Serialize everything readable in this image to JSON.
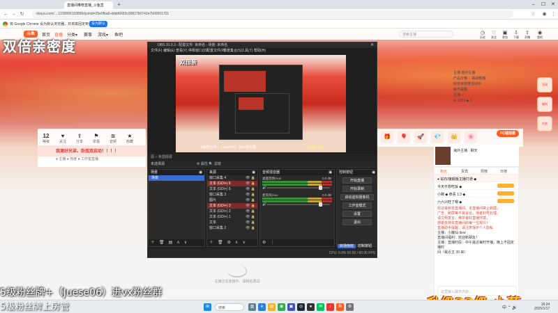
{
  "browser": {
    "tab_title": "直播间推荐直播_斗鱼直",
    "url": "douyu.com/... 1239006118896dyshid=25e0fba0-dddd6693c00837b0742e7b00001701",
    "infobar_msg": "将 Google Chrome 设为默认浏览器，并将其固定到任务栏",
    "infobar_btn": "设为默认"
  },
  "site": {
    "logo": "斗鱼",
    "nav_items": [
      "首页",
      "直播",
      "分类▾",
      "赛事",
      "游戏▾",
      "鱼吧"
    ],
    "search_placeholder": "搜索主播",
    "nav_icons": [
      {
        "icon": "history-icon",
        "label": "历史"
      },
      {
        "icon": "follow-icon",
        "label": "关注"
      },
      {
        "icon": "gift-icon",
        "label": "背包"
      },
      {
        "icon": "download-icon",
        "label": "下载"
      },
      {
        "icon": "upload-icon",
        "label": "开播"
      },
      {
        "icon": "user-icon",
        "label": "我的"
      }
    ],
    "stats": [
      {
        "value": "12",
        "label": "等级"
      },
      {
        "icon": "heart-icon",
        "label": "关注"
      },
      {
        "icon": "share-icon",
        "label": "分享"
      },
      {
        "icon": "flag-icon",
        "label": "举报"
      },
      {
        "icon": "wave-icon",
        "label": "音频"
      },
      {
        "icon": "star-icon",
        "label": "收藏"
      }
    ],
    "live_strip": "我滴好兄弟，卧底双启动！！！！",
    "live_strip_sub": "● 主播 ● 热度 ● 工作室直播",
    "right_info": [
      "主播 签约主播",
      "产品价格 ：挑战到底",
      "双倍亲密度活动中",
      "每日提醒",
      "主播 ✓",
      "★ 1232 ◆ 0"
    ],
    "pc_button": "PC端观看",
    "promo_text": "海外主播 · 聊天"
  },
  "overlay": {
    "title": "双倍亲密度",
    "bottom_left": "5级粉丝牌+（Juese06）进vx粉丝群",
    "bottom_left2": "5级粉丝牌上房管",
    "bottom_right": "升级32级 小菲"
  },
  "chat": {
    "tabs": [
      "粉丝",
      "贵宾",
      "周榜",
      "日榜"
    ],
    "rows": [
      "● 钻石/旗舰版主播打通 ◆",
      "今天不想吃饭 ◆",
      "小碗 ◆ 恭喜 1:3 ◆",
      "六六兴旺了嗯 ◆"
    ],
    "messages": [
      "欢迎来到本直播间，本直播间禁止刷屏，",
      "广告、刷屏等不良言论，违者封号处理，",
      "请文明发言，维护良好直播环境，",
      "感谢支持本直播间的每一位观众！",
      "直播助手提醒：请注意保护个人隐私"
    ],
    "user_lines": [
      "主播：小魔仙 dew",
      "直播间福利：欢迎新朋友！",
      "主播：直播时段：中午最近每时开播，晚上不固定播时",
      "间（最近主 30 来）"
    ],
    "input_placeholder": "这里输入聊天内容..."
  },
  "obs": {
    "title": "OBS 31.0.3 - 配置文件: 未命名 - 场景: 未命名",
    "menu": [
      "文件(F)",
      "编辑(E)",
      "查看(V)",
      "停靠窗口(D)",
      "配置文件(P)",
      "场景集合(S)",
      "工具(T)",
      "帮助(H)"
    ],
    "preview_tag": "双倍亲",
    "preview_caption": "5级粉丝牌+（Juese06）进vx粉丝群",
    "preview_badge": "升级32级",
    "status_row": "源 ○ 未选择源",
    "source_toolbar": "未选择源",
    "toolbar_props": "⚙ 属性  🔍 滤镜",
    "scenes_title": "场景",
    "scene_item": "场景",
    "sources_title": "来源",
    "sources": [
      "窗口采集 4",
      "文本 (GDI+) 6",
      "文本 (GDI+) 5",
      "窗口采集 3",
      "图片",
      "文本 (GDI+) 3",
      "文本 (GDI+) 2",
      "文本 (GDI+) 1",
      "文本",
      "窗口采集 2"
    ],
    "mixer_title": "音频混音器",
    "mixer_channels": [
      {
        "name": "桌面音频/Aux",
        "db": "0.0 dB",
        "level": 0.82
      },
      {
        "name": "麦克风/Aux",
        "db": "0.0 dB",
        "level": 0.82
      }
    ],
    "controls_title": "控制按钮",
    "controls": [
      "开始直播",
      "开始录制",
      "启动虚拟摄像机",
      "工作室模式",
      "设置",
      "退出"
    ],
    "bottom_tabs": [
      "转场特效",
      "控制按钮"
    ],
    "status_bar": "CPU: 0.8%  60.00 / 60.00 FPS"
  },
  "page_loading": "主播正在连接中，请稍后再试",
  "taskbar": {
    "search": "搜索",
    "tray": "中 ⌃ 🔊",
    "time": "16:24",
    "date": "2025/1/17",
    "apps": [
      {
        "icon": "windows-icon",
        "color": "#1e88e5"
      },
      {
        "icon": "task-view-icon",
        "color": "#607d8b"
      },
      {
        "icon": "edge-icon",
        "color": "#2b7fd9"
      },
      {
        "icon": "explorer-icon",
        "color": "#f2b22e"
      },
      {
        "icon": "chrome-icon",
        "color": "#34a853"
      },
      {
        "icon": "store-icon",
        "color": "#3f51b5"
      },
      {
        "icon": "steam-icon",
        "color": "#1b2838"
      },
      {
        "icon": "obs-icon",
        "color": "#333333"
      },
      {
        "icon": "wechat-icon",
        "color": "#07c160"
      },
      {
        "icon": "music-icon",
        "color": "#e53935"
      },
      {
        "icon": "douyu-icon",
        "color": "#ff5d23"
      },
      {
        "icon": "settings-icon",
        "color": "#757575"
      }
    ]
  }
}
